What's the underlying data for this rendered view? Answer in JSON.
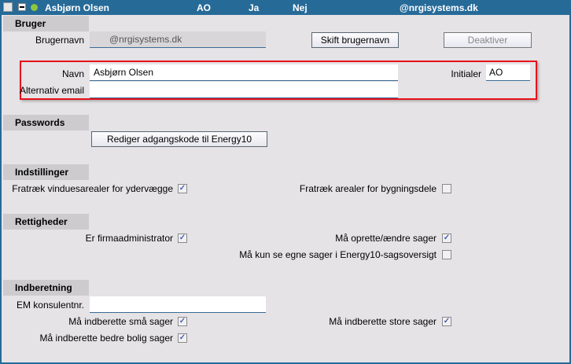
{
  "header": {
    "name": "Asbjørn Olsen",
    "initials": "AO",
    "col1": "Ja",
    "col2": "Nej",
    "email": "@nrgisystems.dk",
    "status_color": "#8CC63F"
  },
  "bruger": {
    "title": "Bruger",
    "username_label": "Brugernavn",
    "username_value": "@nrgisystems.dk",
    "change_username": "Skift brugernavn",
    "deactivate": "Deaktiver",
    "name_label": "Navn",
    "name_value": "Asbjørn Olsen",
    "alt_email_label": "Alternativ email",
    "alt_email_value": "",
    "initials_label": "Initialer",
    "initials_value": "AO"
  },
  "passwords": {
    "title": "Passwords",
    "edit_password": "Rediger adgangskode til Energy10"
  },
  "indstillinger": {
    "title": "Indstillinger",
    "opt1": {
      "label": "Fratræk vinduesarealer for ydervægge",
      "checked": true
    },
    "opt2": {
      "label": "Fratræk arealer for bygningsdele",
      "checked": false
    }
  },
  "rettigheder": {
    "title": "Rettigheder",
    "opt1": {
      "label": "Er firmaadministrator",
      "checked": true
    },
    "opt2": {
      "label": "Må oprette/ændre sager",
      "checked": true
    },
    "opt3": {
      "label": "Må kun se egne sager i Energy10-sagsoversigt",
      "checked": false
    }
  },
  "indberetning": {
    "title": "Indberetning",
    "em_label": "EM konsulentnr.",
    "em_value": "",
    "opt1": {
      "label": "Må indberette små sager",
      "checked": true
    },
    "opt2": {
      "label": "Må indberette store sager",
      "checked": true
    },
    "opt3": {
      "label": "Må indberette bedre bolig sager",
      "checked": true
    }
  }
}
